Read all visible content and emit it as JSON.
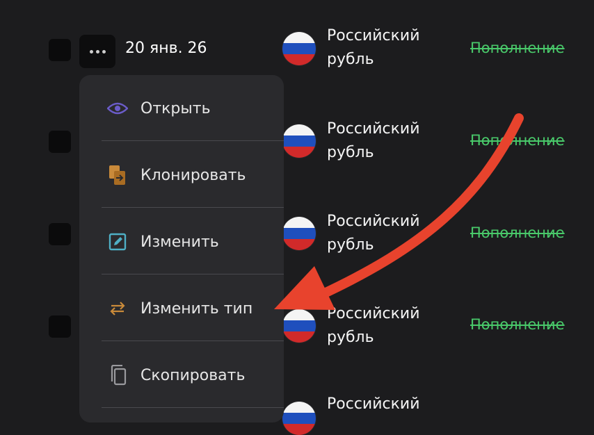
{
  "first_row": {
    "date": "20 янв. 26"
  },
  "rows": [
    {
      "currency": "Российский рубль",
      "type": "Пополнение"
    },
    {
      "currency": "Российский рубль",
      "type": "Пополнение"
    },
    {
      "currency": "Российский рубль",
      "type": "Пополнение"
    },
    {
      "currency": "Российский рубль",
      "type": "Пополнение"
    },
    {
      "currency": "Российский",
      "type": ""
    }
  ],
  "context_menu": {
    "items": [
      {
        "label": "Открыть",
        "icon": "eye-icon",
        "color": "#6b5cc9"
      },
      {
        "label": "Клонировать",
        "icon": "clone-icon",
        "color": "#c98a3a"
      },
      {
        "label": "Изменить",
        "icon": "edit-icon",
        "color": "#4fb0c6"
      },
      {
        "label": "Изменить тип",
        "icon": "swap-arrows-icon",
        "color": "#c98a3a"
      },
      {
        "label": "Скопировать",
        "icon": "copy-icon",
        "color": "#9a9a9e"
      }
    ]
  },
  "colors": {
    "background": "#1c1c1e",
    "menu": "#2a2a2d",
    "type_text": "#49c96a",
    "annotation_arrow": "#e8432d"
  }
}
